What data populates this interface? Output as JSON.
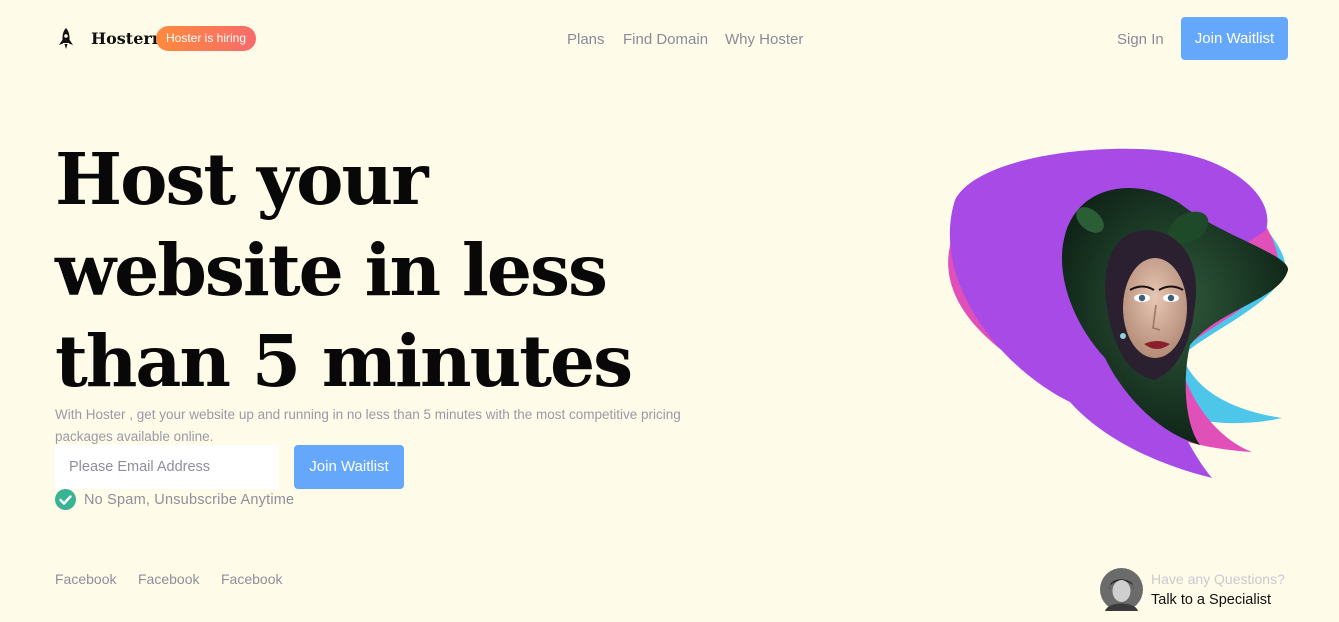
{
  "nav": {
    "brand": "Hosterr",
    "badge": "Hoster is hiring",
    "links": [
      "Plans",
      "Find Domain",
      "Why Hoster"
    ],
    "signin": "Sign In",
    "cta": "Join Waitlist",
    "logo_icon": "rocket-icon"
  },
  "hero": {
    "headline": "Host your website in less than 5 minutes",
    "subtext": "With Hoster , get your website up and running in no less than 5 minutes with the most competitive pricing packages available online.",
    "email_placeholder": "Please Email Address",
    "join_label": "Join Waitlist",
    "note": "No Spam, Unsubscribe Anytime",
    "check_icon": "check-circle-icon"
  },
  "social": [
    "Facebook",
    "Facebook",
    "Facebook"
  ],
  "support": {
    "question": "Have any Questions?",
    "cta": "Talk to a Specialist"
  },
  "colors": {
    "background": "#fefbe8",
    "accent": "#64a7fb",
    "badge_start": "#ff8a3d",
    "badge_end": "#f76b6b",
    "check": "#3ab394",
    "art_purple": "#a84be6",
    "art_pink": "#e14fb8",
    "art_cyan": "#4ec6ea"
  }
}
